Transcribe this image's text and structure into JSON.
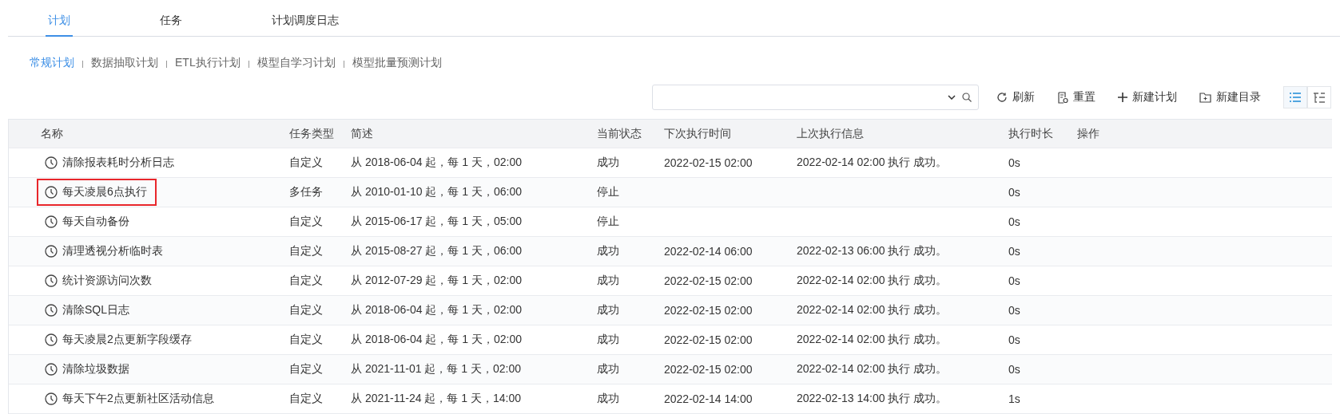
{
  "tabs": [
    {
      "label": "计划",
      "selected": true
    },
    {
      "label": "任务",
      "selected": false
    },
    {
      "label": "计划调度日志",
      "selected": false
    }
  ],
  "categories": [
    {
      "label": "常规计划",
      "selected": true
    },
    {
      "label": "数据抽取计划",
      "selected": false
    },
    {
      "label": "ETL执行计划",
      "selected": false
    },
    {
      "label": "模型自学习计划",
      "selected": false
    },
    {
      "label": "模型批量预测计划",
      "selected": false
    }
  ],
  "toolbar": [
    {
      "label": "刷新",
      "kind": "refresh"
    },
    {
      "label": "重置",
      "kind": "reset"
    },
    {
      "label": "新建计划",
      "kind": "add"
    },
    {
      "label": "新建目录",
      "kind": "folder"
    }
  ],
  "view_toggles": [
    {
      "kind": "list",
      "selected": true
    },
    {
      "kind": "tree",
      "selected": false
    }
  ],
  "table": {
    "columns": [
      "名称",
      "任务类型",
      "简述",
      "当前状态",
      "下次执行时间",
      "上次执行信息",
      "执行时长",
      "操作"
    ],
    "rows": [
      {
        "name": "清除报表耗时分析日志",
        "type": "自定义",
        "description": "从 2018-06-04 起，每 1 天，02:00",
        "status": "成功",
        "next_run": "2022-02-15 02:00",
        "last_run": "2022-02-14 02:00 执行 成功。",
        "duration": "0s",
        "highlighted": false
      },
      {
        "name": "每天凌晨6点执行",
        "type": "多任务",
        "description": "从 2010-01-10 起，每 1 天，06:00",
        "status": "停止",
        "duration": "0s",
        "highlighted": true
      },
      {
        "name": "每天自动备份",
        "type": "自定义",
        "description": "从 2015-06-17 起，每 1 天，05:00",
        "status": "停止",
        "duration": "0s",
        "highlighted": false
      },
      {
        "name": "清理透视分析临时表",
        "type": "自定义",
        "description": "从 2015-08-27 起，每 1 天，06:00",
        "status": "成功",
        "next_run": "2022-02-14 06:00",
        "last_run": "2022-02-13 06:00 执行 成功。",
        "duration": "0s",
        "highlighted": false
      },
      {
        "name": "统计资源访问次数",
        "type": "自定义",
        "description": "从 2012-07-29 起，每 1 天，02:00",
        "status": "成功",
        "next_run": "2022-02-15 02:00",
        "last_run": "2022-02-14 02:00 执行 成功。",
        "duration": "0s",
        "highlighted": false
      },
      {
        "name": "清除SQL日志",
        "type": "自定义",
        "description": "从 2018-06-04 起，每 1 天，02:00",
        "status": "成功",
        "next_run": "2022-02-15 02:00",
        "last_run": "2022-02-14 02:00 执行 成功。",
        "duration": "0s",
        "highlighted": false
      },
      {
        "name": "每天凌晨2点更新字段缓存",
        "type": "自定义",
        "description": "从 2018-06-04 起，每 1 天，02:00",
        "status": "成功",
        "next_run": "2022-02-15 02:00",
        "last_run": "2022-02-14 02:00 执行 成功。",
        "duration": "0s",
        "highlighted": false
      },
      {
        "name": "清除垃圾数据",
        "type": "自定义",
        "description": "从 2021-11-01 起，每 1 天，02:00",
        "status": "成功",
        "next_run": "2022-02-15 02:00",
        "last_run": "2022-02-14 02:00 执行 成功。",
        "duration": "0s",
        "highlighted": false
      },
      {
        "name": "每天下午2点更新社区活动信息",
        "type": "自定义",
        "description": "从 2021-11-24 起，每 1 天，14:00",
        "status": "成功",
        "next_run": "2022-02-14 14:00",
        "last_run": "2022-02-13 14:00 执行 成功。",
        "duration": "1s",
        "highlighted": false
      }
    ]
  }
}
